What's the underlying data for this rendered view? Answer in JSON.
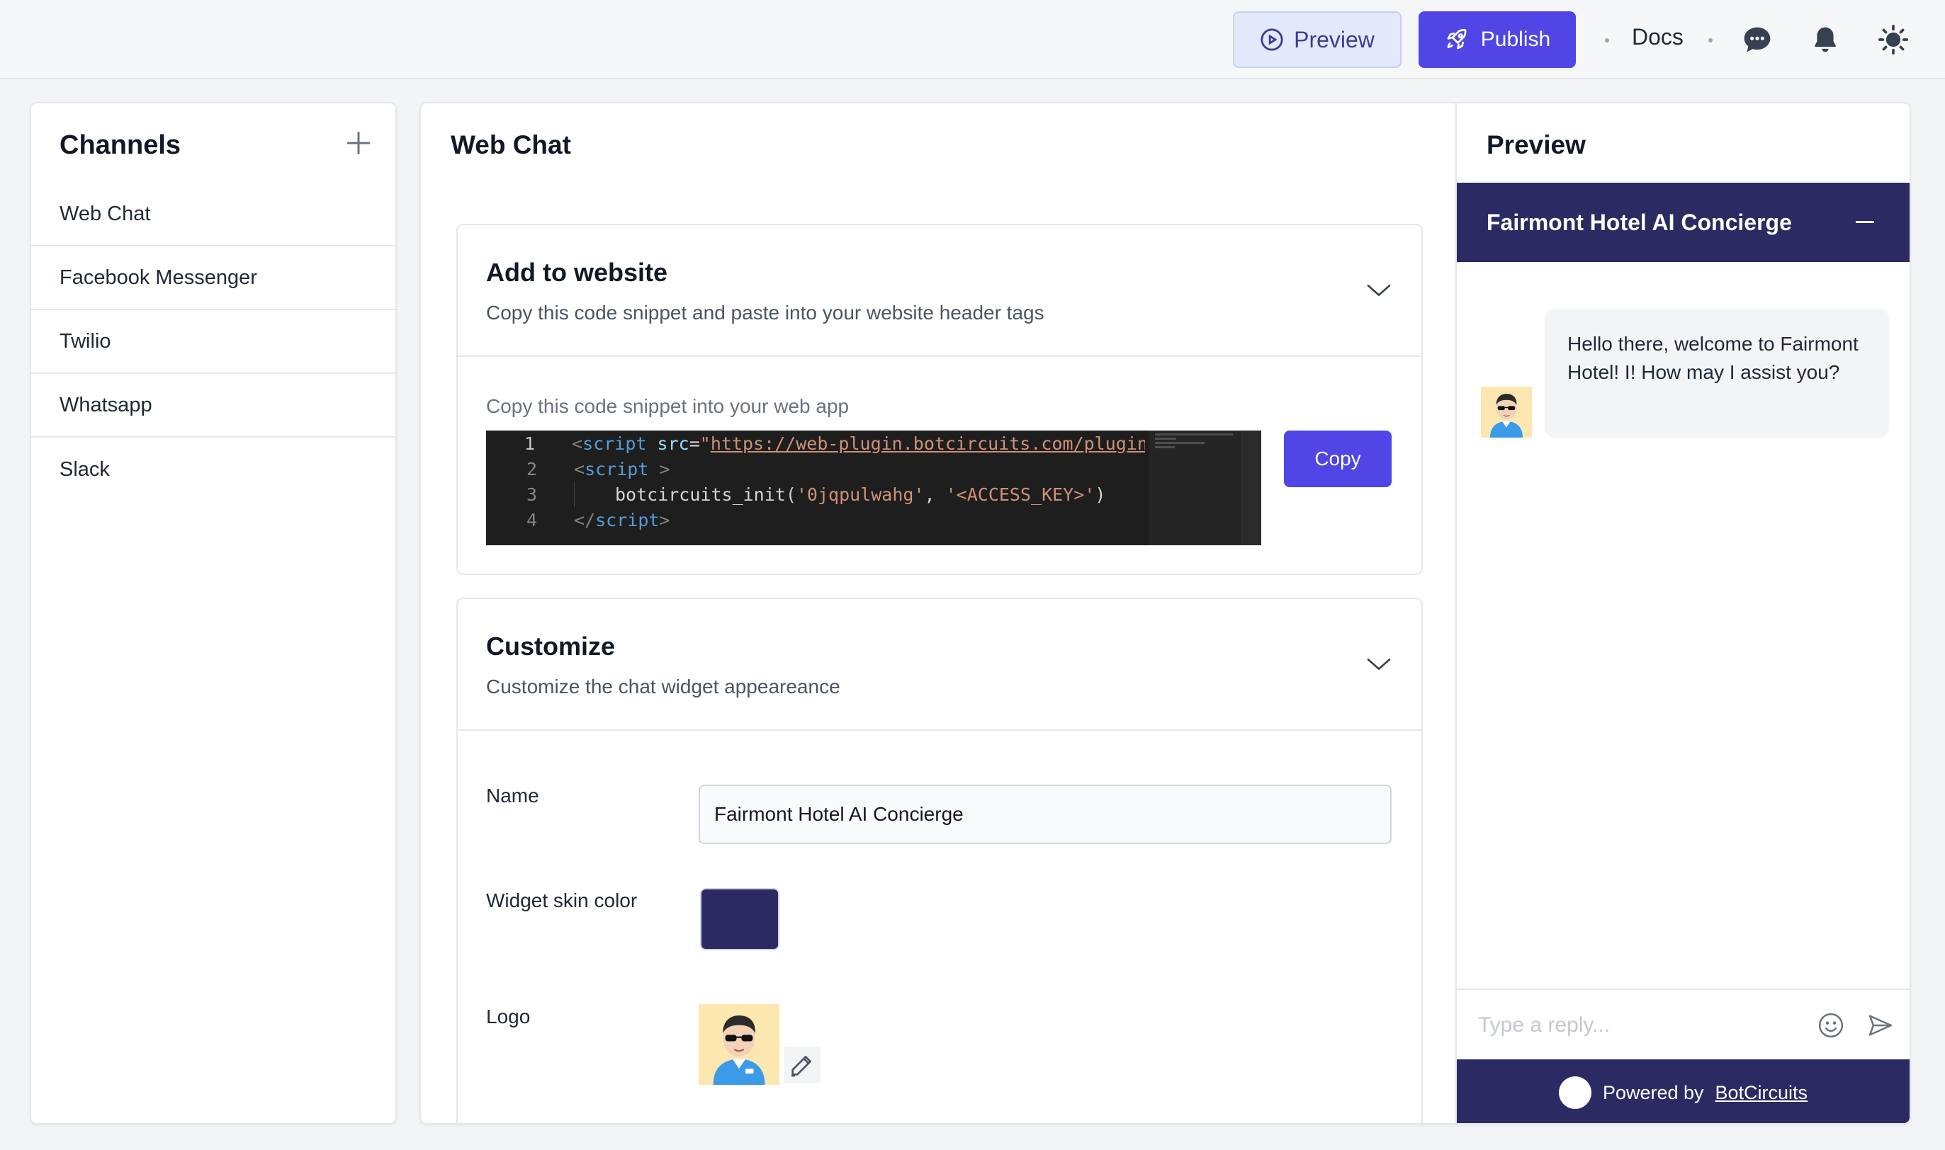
{
  "colors": {
    "accent": "#4f46e5",
    "widget_skin": "#2b2a63"
  },
  "topbar": {
    "preview_label": "Preview",
    "publish_label": "Publish",
    "docs_label": "Docs",
    "icons": [
      "play-circle-icon",
      "rocket-icon",
      "chat-bubble-icon",
      "bell-icon",
      "sun-icon"
    ]
  },
  "channels": {
    "title": "Channels",
    "items": [
      "Web Chat",
      "Facebook Messenger",
      "Twilio",
      "Whatsapp",
      "Slack"
    ]
  },
  "main": {
    "title": "Web Chat",
    "add_to_website": {
      "title": "Add to website",
      "subtitle": "Copy this code snippet and paste into your website header tags",
      "snippet_label": "Copy this code snippet into your web app",
      "copy_label": "Copy",
      "code": {
        "line_numbers": [
          "1",
          "2",
          "3",
          "4"
        ],
        "url": "https://web-plugin.botcircuits.com/plugin/s",
        "init_fn": "botcircuits_init(",
        "arg1": "'0jqpulwahg'",
        "arg2": "'<ACCESS_KEY>'"
      }
    },
    "customize": {
      "title": "Customize",
      "subtitle": "Customize the chat widget appeareance",
      "name_label": "Name",
      "name_value": "Fairmont Hotel AI Concierge",
      "skin_label": "Widget skin color",
      "logo_label": "Logo"
    }
  },
  "preview": {
    "title": "Preview",
    "widget_title": "Fairmont Hotel AI Concierge",
    "message": "Hello there, welcome to Fairmont Hotel! I! How may I assist you?",
    "reply_placeholder": "Type a reply...",
    "powered_prefix": "Powered by",
    "powered_link": "BotCircuits"
  }
}
